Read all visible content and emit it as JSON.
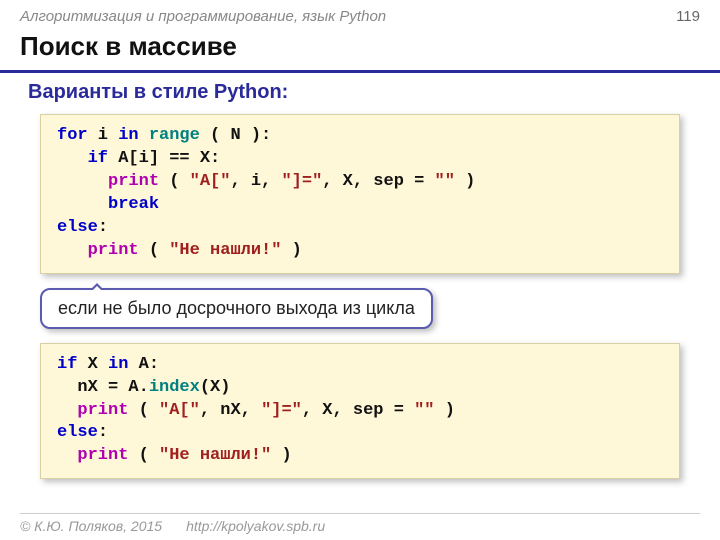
{
  "header": {
    "topic": "Алгоритмизация и программирование, язык Python",
    "page": "119"
  },
  "title": "Поиск в массиве",
  "subtitle": "Варианты в стиле Python:",
  "code1": {
    "l1a": "for",
    "l1b": " i ",
    "l1c": "in",
    "l1d": " ",
    "l1e": "range",
    "l1f": " ( N ):",
    "l2a": "   if",
    "l2b": " A[i] == X:",
    "l3a": "     print",
    "l3b": " ( ",
    "l3c": "\"A[\"",
    "l3d": ", i, ",
    "l3e": "\"]=\"",
    "l3f": ", X, sep = ",
    "l3g": "\"\"",
    "l3h": " )",
    "l4a": "     break",
    "l5a": "else",
    "l5b": ":",
    "l6a": "   print",
    "l6b": " ( ",
    "l6c": "\"Не нашли!\"",
    "l6d": " )"
  },
  "callout": "если не было досрочного выхода из цикла",
  "code2": {
    "l1a": "if",
    "l1b": " X ",
    "l1c": "in",
    "l1d": " A:",
    "l2a": "  nX = A.",
    "l2b": "index",
    "l2c": "(X)",
    "l3a": "  print",
    "l3b": " ( ",
    "l3c": "\"A[\"",
    "l3d": ", nX, ",
    "l3e": "\"]=\"",
    "l3f": ", X, sep = ",
    "l3g": "\"\"",
    "l3h": " )",
    "l4a": "else",
    "l4b": ":",
    "l5a": "  print",
    "l5b": " ( ",
    "l5c": "\"Не нашли!\"",
    "l5d": " )"
  },
  "footer": {
    "copyright": "© К.Ю. Поляков, 2015",
    "url": "http://kpolyakov.spb.ru"
  }
}
